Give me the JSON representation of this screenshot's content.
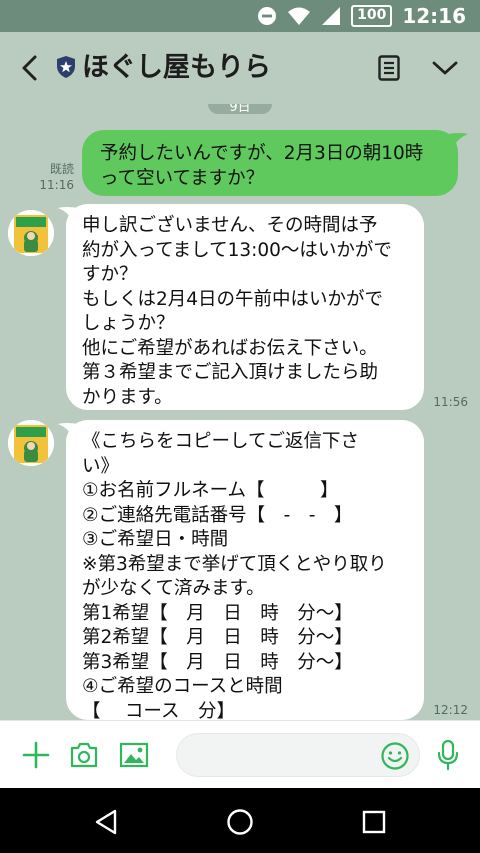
{
  "status_bar": {
    "battery": "100",
    "time": "12:16"
  },
  "header": {
    "title": "ほぐし屋もりら"
  },
  "chat": {
    "date_chip": "9日",
    "messages": [
      {
        "direction": "out",
        "text": "予約したいんですが、2月3日の朝10時\nって空いてますか？",
        "read_label": "既読",
        "time": "11:16"
      },
      {
        "direction": "in",
        "text": "申し訳ございません、その時間は予\n約が入ってまして13:00〜はいかがで\nすか？\nもしくは2月4日の午前中はいかがで\nしょうか？\n他にご希望があればお伝え下さい。\n第３希望までご記入頂けましたら助\nかります。",
        "time": "11:56"
      },
      {
        "direction": "in",
        "text": "《こちらをコピーしてご返信下さ\nい》\n①お名前フルネーム【　　　】\n②ご連絡先電話番号【　-　-　】\n③ご希望日・時間\n※第3希望まで挙げて頂くとやり取り\nが少なくて済みます。\n第1希望【　月　日　時　分〜】\n第2希望【　月　日　時　分〜】\n第3希望【　月　日　時　分〜】\n④ご希望のコースと時間\n【　 コース　分】",
        "time": "12:12"
      }
    ],
    "avatar_logo": {
      "line1": "ほぐし屋",
      "line2": "もりら"
    }
  },
  "composer": {
    "placeholder": ""
  },
  "colors": {
    "chat_bg": "#b9ccbf",
    "status_bar": "#6e8c7b",
    "outgoing_bubble": "#5fc95d",
    "incoming_bubble": "#ffffff",
    "accent_green": "#2fb75c"
  },
  "icons": {
    "back": "chevron-left-icon",
    "shield": "shield-star-icon",
    "note": "note-icon",
    "expand": "chevron-down-icon",
    "add": "plus-icon",
    "camera": "camera-icon",
    "image": "image-icon",
    "emoji": "smile-icon",
    "mic": "microphone-icon"
  }
}
